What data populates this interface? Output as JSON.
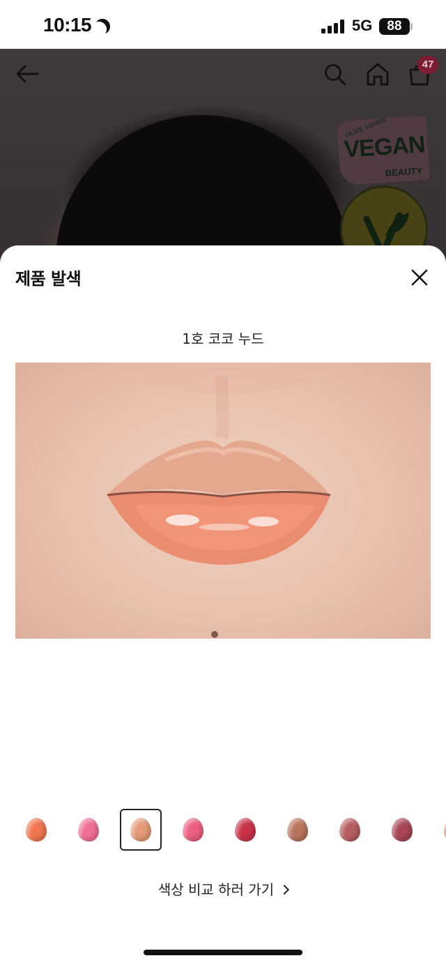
{
  "status_bar": {
    "time": "10:15",
    "network": "5G",
    "battery": "88"
  },
  "header": {
    "cart_count": "47"
  },
  "badges": {
    "vegan_small": "OLIVE YOUNG",
    "vegan_big": "VEGAN",
    "vegan_sub": "BEAUTY"
  },
  "sheet": {
    "title": "제품 발색",
    "shade_name": "1호 코코 누드",
    "compare_link": "색상 비교 하러 가기"
  },
  "shades": [
    {
      "color": "#f0764f",
      "selected": false
    },
    {
      "color": "#ef6f96",
      "selected": false
    },
    {
      "color": "#e49a78",
      "selected": true
    },
    {
      "color": "#ec5f80",
      "selected": false
    },
    {
      "color": "#c8334a",
      "selected": false
    },
    {
      "color": "#b8755d",
      "selected": false
    },
    {
      "color": "#b55d62",
      "selected": false
    },
    {
      "color": "#a84656",
      "selected": false
    },
    {
      "color": "#d98e78",
      "selected": false
    }
  ],
  "colors": {
    "accent_badge": "#7a1d32",
    "text": "#111111"
  }
}
